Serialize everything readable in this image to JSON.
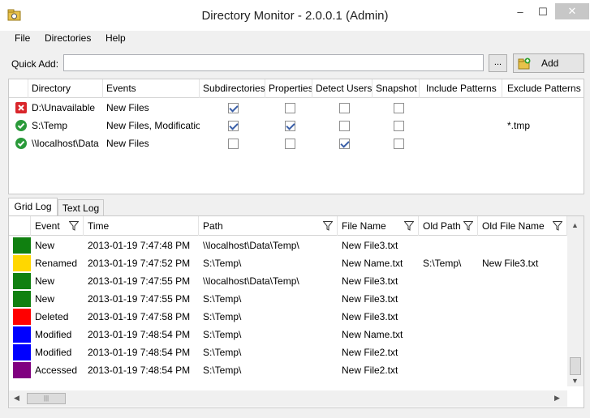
{
  "window": {
    "title": "Directory Monitor - 2.0.0.1 (Admin)",
    "minimize": "–",
    "maximize": "☐",
    "close": "✕"
  },
  "menu": [
    "File",
    "Directories",
    "Help"
  ],
  "quick_add": {
    "label": "Quick Add:",
    "value": "",
    "browse_label": "...",
    "add_label": "Add"
  },
  "directories": {
    "columns": [
      "Directory",
      "Events",
      "Subdirectories",
      "Properties",
      "Detect Users",
      "Snapshot",
      "Include Patterns",
      "Exclude Patterns"
    ],
    "rows": [
      {
        "status": "error",
        "directory": "D:\\Unavailable",
        "events": "New Files",
        "subdirectories": true,
        "properties": false,
        "detect_users": false,
        "snapshot": false,
        "include": "",
        "exclude": ""
      },
      {
        "status": "ok",
        "directory": "S:\\Temp",
        "events": "New Files, Modificatio...",
        "subdirectories": true,
        "properties": true,
        "detect_users": false,
        "snapshot": false,
        "include": "",
        "exclude": "*.tmp"
      },
      {
        "status": "ok",
        "directory": "\\\\localhost\\Data",
        "events": "New Files",
        "subdirectories": false,
        "properties": false,
        "detect_users": true,
        "snapshot": false,
        "include": "",
        "exclude": ""
      }
    ]
  },
  "tabs": [
    "Grid Log",
    "Text Log"
  ],
  "log": {
    "columns": [
      "Event",
      "Time",
      "Path",
      "File Name",
      "Old Path",
      "Old File Name"
    ],
    "rows": [
      {
        "color": "#108010",
        "event": "New",
        "time": "2013-01-19 7:47:48 PM",
        "path": "\\\\localhost\\Data\\Temp\\",
        "file": "New File3.txt",
        "old_path": "",
        "old_file": ""
      },
      {
        "color": "#ffd700",
        "event": "Renamed",
        "time": "2013-01-19 7:47:52 PM",
        "path": "S:\\Temp\\",
        "file": "New Name.txt",
        "old_path": "S:\\Temp\\",
        "old_file": "New File3.txt"
      },
      {
        "color": "#108010",
        "event": "New",
        "time": "2013-01-19 7:47:55 PM",
        "path": "\\\\localhost\\Data\\Temp\\",
        "file": "New File3.txt",
        "old_path": "",
        "old_file": ""
      },
      {
        "color": "#108010",
        "event": "New",
        "time": "2013-01-19 7:47:55 PM",
        "path": "S:\\Temp\\",
        "file": "New File3.txt",
        "old_path": "",
        "old_file": ""
      },
      {
        "color": "#ff0000",
        "event": "Deleted",
        "time": "2013-01-19 7:47:58 PM",
        "path": "S:\\Temp\\",
        "file": "New File3.txt",
        "old_path": "",
        "old_file": ""
      },
      {
        "color": "#0000ff",
        "event": "Modified",
        "time": "2013-01-19 7:48:54 PM",
        "path": "S:\\Temp\\",
        "file": "New Name.txt",
        "old_path": "",
        "old_file": ""
      },
      {
        "color": "#0000ff",
        "event": "Modified",
        "time": "2013-01-19 7:48:54 PM",
        "path": "S:\\Temp\\",
        "file": "New File2.txt",
        "old_path": "",
        "old_file": ""
      },
      {
        "color": "#800080",
        "event": "Accessed",
        "time": "2013-01-19 7:48:54 PM",
        "path": "S:\\Temp\\",
        "file": "New File2.txt",
        "old_path": "",
        "old_file": ""
      }
    ]
  },
  "icons": {
    "app": "folder-monitor-icon",
    "add": "add-folder-icon",
    "filter": "filter-funnel-icon",
    "error": "red-x-icon",
    "ok": "green-check-icon"
  }
}
